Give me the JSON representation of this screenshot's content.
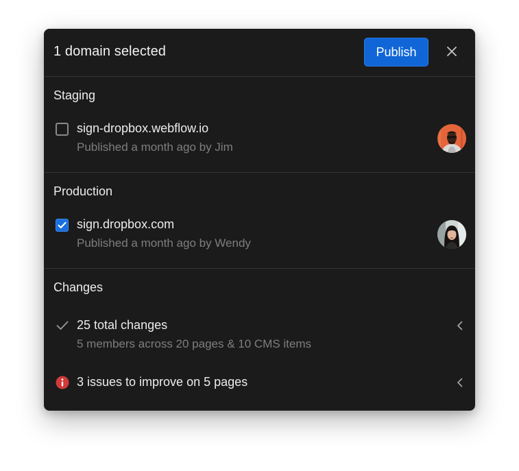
{
  "header": {
    "title": "1 domain selected",
    "publish_label": "Publish",
    "close_icon": "close-icon"
  },
  "staging": {
    "title": "Staging",
    "domain": "sign-dropbox.webflow.io",
    "subtitle": "Published a month ago by Jim",
    "checked": false
  },
  "production": {
    "title": "Production",
    "domain": "sign.dropbox.com",
    "subtitle": "Published a month ago by Wendy",
    "checked": true
  },
  "changes": {
    "title": "Changes",
    "summary": {
      "label": "25 total changes",
      "detail": "5 members across 20 pages & 10 CMS items",
      "icon": "checkmark-icon"
    },
    "issues": {
      "label": "3 issues to improve on 5 pages",
      "icon": "alert-icon"
    }
  },
  "colors": {
    "panel_bg": "#1b1b1b",
    "accent": "#1066d6",
    "alert": "#d13a3a"
  }
}
